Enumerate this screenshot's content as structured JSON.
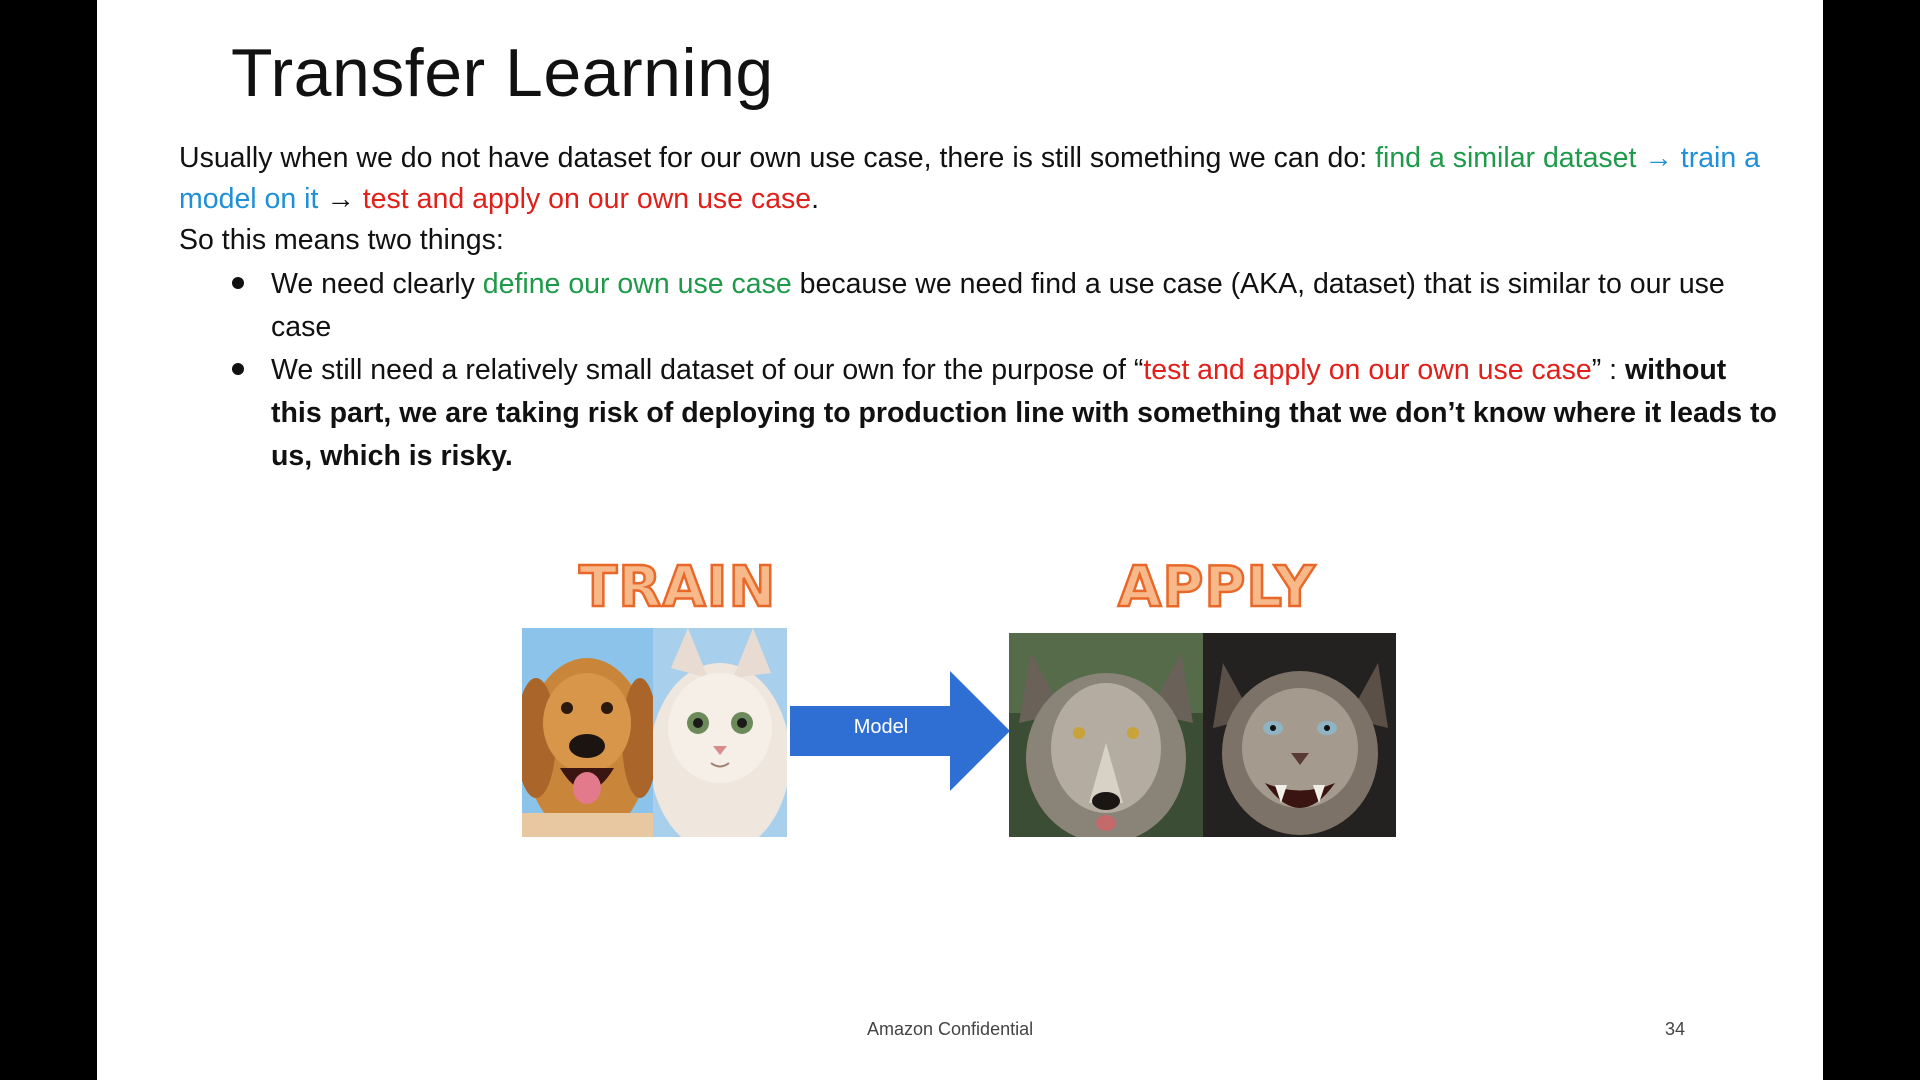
{
  "slide": {
    "title": "Transfer Learning",
    "intro": {
      "text": "Usually when we do not have dataset for our own use case, there is still something we can do:  ",
      "step1": "find a similar dataset",
      "arrow": "→",
      "step2": "train a model on it",
      "arrow2": "→",
      "step3": "test and apply on our own use case",
      "end": "."
    },
    "so_line": "So this means two things:",
    "bullets": [
      {
        "pre": "We need clearly ",
        "highlight": "define our own use case",
        "post": " because we need find a use case (AKA, dataset) that is similar to our use case"
      },
      {
        "pre": "We still need a relatively small dataset of our own for the purpose of “",
        "highlight": "test and apply on our own use case",
        "post": "” : ",
        "bold": "without this part, we are taking risk of deploying to production line with something that we don’t know where it leads to us, which is risky."
      }
    ],
    "diagram": {
      "train_label": "TRAIN",
      "apply_label": "APPLY",
      "arrow_label": "Model",
      "train_images": [
        "dog-photo",
        "cat-photo"
      ],
      "apply_images": [
        "wolf-photo",
        "cougar-photo"
      ]
    },
    "footer": {
      "confidential": "Amazon Confidential",
      "page_number": "34"
    }
  },
  "colors": {
    "green": "#1e9a4a",
    "blue": "#1f8fd6",
    "red": "#e0201b",
    "arrow_fill": "#2f6fd4",
    "label_fill": "#f7b88a",
    "label_stroke": "#e8682a"
  }
}
